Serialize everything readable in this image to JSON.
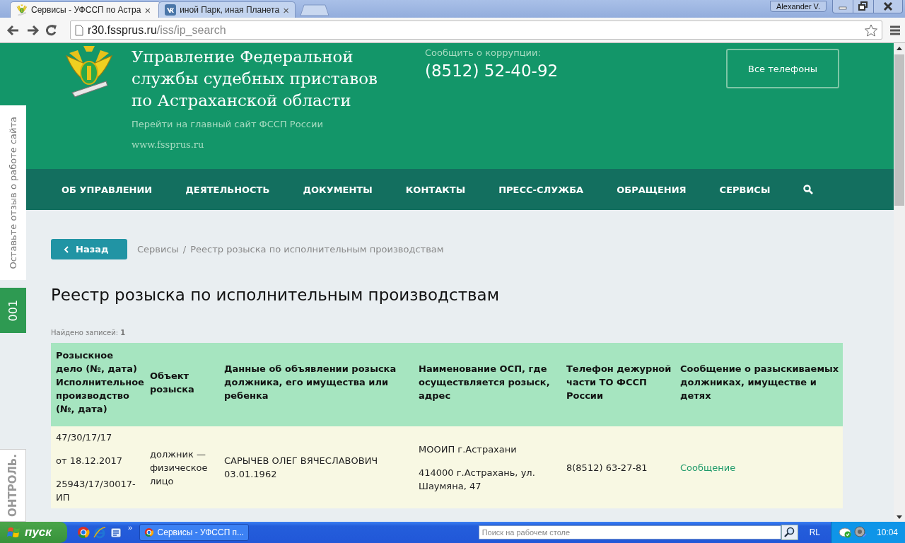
{
  "browser": {
    "tabs": [
      {
        "title": "Сервисы - УФССП по Астра",
        "selected": true,
        "close": "×",
        "kind": "emblem"
      },
      {
        "title": "иной Парк, иная Планета",
        "selected": false,
        "close": "×",
        "kind": "vk"
      }
    ],
    "user": "Alexander V.",
    "address": {
      "host": "r30.fssprus.ru",
      "path": "/iss/ip_search"
    }
  },
  "header": {
    "title_lines": [
      "Управление Федеральной",
      "службы судебных приставов",
      "по Астраханской области"
    ],
    "main_site_link": "Перейти на главный сайт ФССП России",
    "site_url": "www.fssprus.ru",
    "corruption_label": "Сообщить о коррупции:",
    "phone": "(8512) 52-40-92",
    "all_phones_button": "Все телефоны"
  },
  "nav": {
    "items": [
      "ОБ УПРАВЛЕНИИ",
      "ДЕЯТЕЛЬНОСТЬ",
      "ДОКУМЕНТЫ",
      "КОНТАКТЫ",
      "ПРЕСС-СЛУЖБА",
      "ОБРАЩЕНИЯ",
      "СЕРВИСЫ"
    ]
  },
  "side_tabs": {
    "feedback": "Оставьте отзыв о работе сайта",
    "counter": "001",
    "control": "ОНТРОЛЬ."
  },
  "back_button": "Назад",
  "breadcrumb": {
    "items": [
      "Сервисы",
      "Реестр розыска по исполнительным производствам"
    ],
    "separator": "/"
  },
  "heading": "Реестр розыска по исполнительным производствам",
  "found": "Найдено записей: **1**",
  "table": {
    "columns": [
      "Розыскное дело (№, дата) Исполнительное производство (№, дата)",
      "Объект розыска",
      "Данные об объявлении розыска должника, его имущества или ребенка",
      "Наименование ОСП, где осуществляется розыск, адрес",
      "Телефон дежурной части ТО ФССП России",
      "Сообщение о разыскиваемых должниках, имуществе и детях"
    ],
    "rows": [
      [
        {
          "kind": "text",
          "paragraphs": [
            "47/30/17/17",
            "от 18.12.2017",
            "25943/17/30017-ИП"
          ]
        },
        {
          "kind": "text",
          "paragraphs": [
            "должник — физическое лицо"
          ]
        },
        {
          "kind": "text",
          "paragraphs": [
            "САРЫЧЕВ ОЛЕГ ВЯЧЕСЛАВОВИЧ 03.01.1962"
          ]
        },
        {
          "kind": "text",
          "paragraphs": [
            "МООИП г.Астрахани",
            "414000 г.Астрахань, ул. Шаумяна, 47"
          ]
        },
        {
          "kind": "text",
          "paragraphs": [
            "8(8512) 63-27-81"
          ]
        },
        {
          "kind": "link",
          "paragraphs": [
            "Сообщение"
          ]
        }
      ]
    ]
  },
  "taskbar": {
    "start": "пуск",
    "more": "»",
    "task": "Сервисы - УФССП п...",
    "search_placeholder": "Поиск на рабочем столе",
    "language": "RL",
    "clock": "10:04"
  }
}
